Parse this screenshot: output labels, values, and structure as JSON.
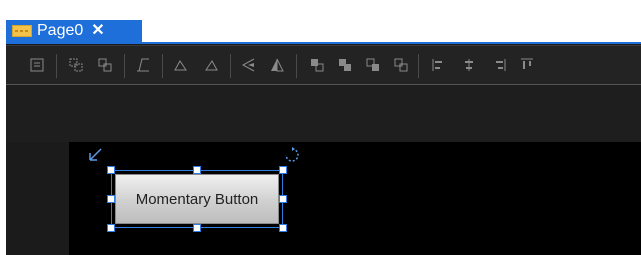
{
  "tab": {
    "label": "Page0",
    "close": "✕"
  },
  "toolbar": {
    "icons": [
      "properties-icon",
      "group-icon",
      "ungroup-icon",
      "skew-icon",
      "rotate-left-icon",
      "rotate-right-icon",
      "flip-horizontal-icon",
      "flip-vertical-icon",
      "bring-front-icon",
      "send-back-icon",
      "bring-forward-icon",
      "send-backward-icon",
      "align-left-icon",
      "align-center-icon",
      "align-right-icon",
      "align-top-icon"
    ]
  },
  "canvas": {
    "widget": {
      "label": "Momentary Button"
    }
  },
  "colors": {
    "accent": "#1e6fd9",
    "workspace": "#1b1b1b",
    "canvas": "#000000",
    "selection": "#2f7de0"
  }
}
